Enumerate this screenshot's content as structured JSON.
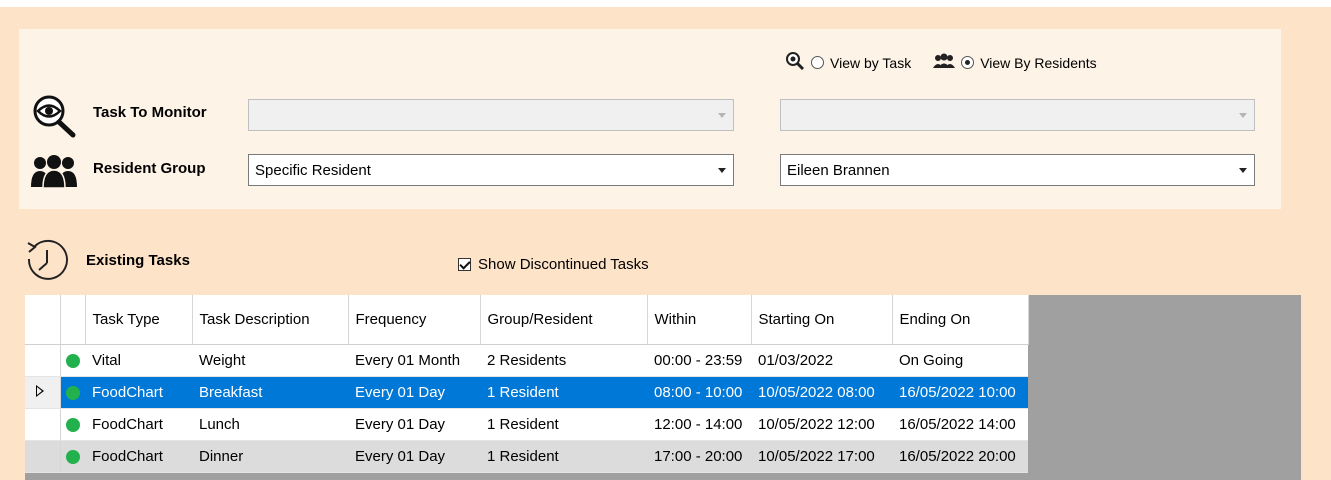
{
  "view_toggle": {
    "by_task_label": "View by Task",
    "by_residents_label": "View By Residents",
    "selected": "residents"
  },
  "filters": {
    "task_to_monitor_label": "Task To Monitor",
    "task_primary_value": "",
    "task_secondary_value": "",
    "resident_group_label": "Resident Group",
    "resident_group_value": "Specific Resident",
    "resident_value": "Eileen Brannen"
  },
  "existing": {
    "title": "Existing Tasks",
    "show_discontinued_label": "Show Discontinued Tasks",
    "show_discontinued_checked": true
  },
  "table": {
    "columns": [
      "Task Type",
      "Task Description",
      "Frequency",
      "Group/Resident",
      "Within",
      "Starting On",
      "Ending On"
    ],
    "rows": [
      {
        "type": "Vital",
        "description": "Weight",
        "frequency": "Every 01 Month",
        "group": "2 Residents",
        "within": "00:00 - 23:59",
        "start": "01/03/2022",
        "end": "On Going",
        "status_color": "#22b14c"
      },
      {
        "type": "FoodChart",
        "description": "Breakfast",
        "frequency": "Every 01 Day",
        "group": "1 Resident",
        "within": "08:00 - 10:00",
        "start": "10/05/2022 08:00",
        "end": "16/05/2022 10:00",
        "status_color": "#22b14c"
      },
      {
        "type": "FoodChart",
        "description": "Lunch",
        "frequency": "Every 01 Day",
        "group": "1 Resident",
        "within": "12:00 - 14:00",
        "start": "10/05/2022 12:00",
        "end": "16/05/2022 14:00",
        "status_color": "#22b14c"
      },
      {
        "type": "FoodChart",
        "description": "Dinner",
        "frequency": "Every 01 Day",
        "group": "1 Resident",
        "within": "17:00 - 20:00",
        "start": "10/05/2022 17:00",
        "end": "16/05/2022 20:00",
        "status_color": "#22b14c"
      }
    ],
    "selected_row": 1
  },
  "colors": {
    "background": "#fde3c8",
    "panel": "#fdf3e7",
    "selection": "#0078d7",
    "status_active": "#22b14c",
    "grid_empty": "#a0a0a0"
  }
}
